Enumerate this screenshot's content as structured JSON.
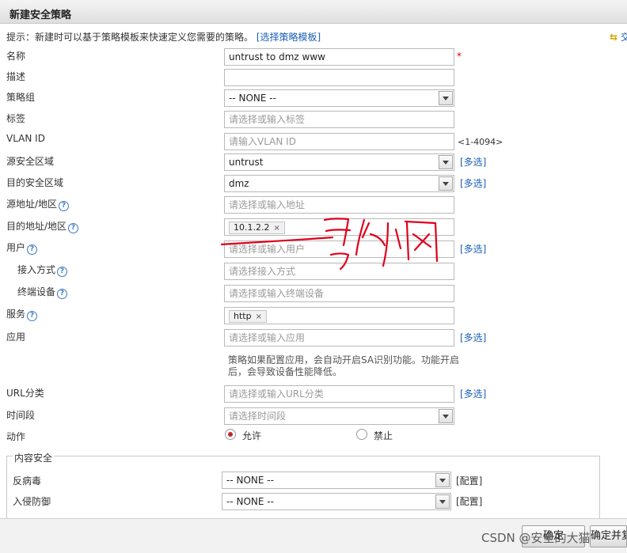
{
  "dialog": {
    "title": "新建安全策略"
  },
  "hint": {
    "text": "提示：新建时可以基于策略模板来快速定义您需要的策略。",
    "link": "[选择策略模板]",
    "right_link": "交"
  },
  "labels": {
    "name": "名称",
    "desc": "描述",
    "group": "策略组",
    "tag": "标签",
    "vlan": "VLAN ID",
    "src_zone": "源安全区域",
    "dst_zone": "目的安全区域",
    "src_addr": "源地址/地区",
    "dst_addr": "目的地址/地区",
    "user": "用户",
    "access": "接入方式",
    "terminal": "终端设备",
    "service": "服务",
    "app": "应用",
    "url": "URL分类",
    "time": "时间段",
    "action": "动作"
  },
  "fields": {
    "name_value": "untrust to dmz www",
    "desc_value": "",
    "group_value": "-- NONE --",
    "tag_placeholder": "请选择或输入标签",
    "vlan_placeholder": "请输入VLAN ID",
    "vlan_range": "<1-4094>",
    "src_zone_value": "untrust",
    "dst_zone_value": "dmz",
    "src_addr_placeholder": "请选择或输入地址",
    "dst_addr_tag": "10.1.2.2",
    "user_placeholder": "请选择或输入用户",
    "access_placeholder": "请选择接入方式",
    "terminal_placeholder": "请选择或输入终端设备",
    "service_tag": "http",
    "app_placeholder": "请选择或输入应用",
    "app_note": "策略如果配置应用，会自动开启SA识别功能。功能开启后，会导致设备性能降低。",
    "url_placeholder": "请选择或输入URL分类",
    "time_placeholder": "请选择时间段"
  },
  "multi_label": "[多选]",
  "required_mark": "*",
  "tag_remove": "×",
  "action": {
    "permit": "允许",
    "deny": "禁止",
    "selected": "permit"
  },
  "content_security": {
    "legend": "内容安全",
    "antivirus_label": "反病毒",
    "antivirus_value": "-- NONE --",
    "ips_label": "入侵防御",
    "ips_value": "-- NONE --",
    "config": "[配置]"
  },
  "buttons": {
    "ok": "确定",
    "ok_continue": "确定并复"
  },
  "watermark": "CSDN @安全的大猫",
  "annotation": {
    "color": "#e0001b"
  }
}
